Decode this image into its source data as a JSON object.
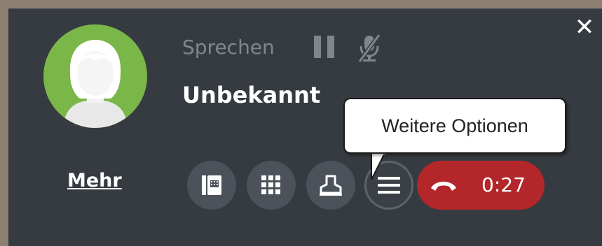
{
  "window": {
    "close_icon": "close-icon",
    "background": "#363b41"
  },
  "caller": {
    "status": "Sprechen",
    "name": "Unbekannt",
    "avatar_icon": "person-avatar-icon",
    "avatar_color": "#7ab648"
  },
  "controls": {
    "pause_icon": "pause-icon",
    "mute_icon": "microphone-muted-icon",
    "more_label": "Mehr",
    "buttons": [
      {
        "name": "transfer-button",
        "icon": "phone-book-icon"
      },
      {
        "name": "dialpad-button",
        "icon": "keypad-icon"
      },
      {
        "name": "consult-button",
        "icon": "person-stamp-icon"
      },
      {
        "name": "options-button",
        "icon": "menu-lines-icon"
      }
    ],
    "hangup": {
      "icon": "phone-hangup-icon",
      "timer": "0:27",
      "color": "#b3262a"
    }
  },
  "tooltip": {
    "text": "Weitere Optionen"
  }
}
